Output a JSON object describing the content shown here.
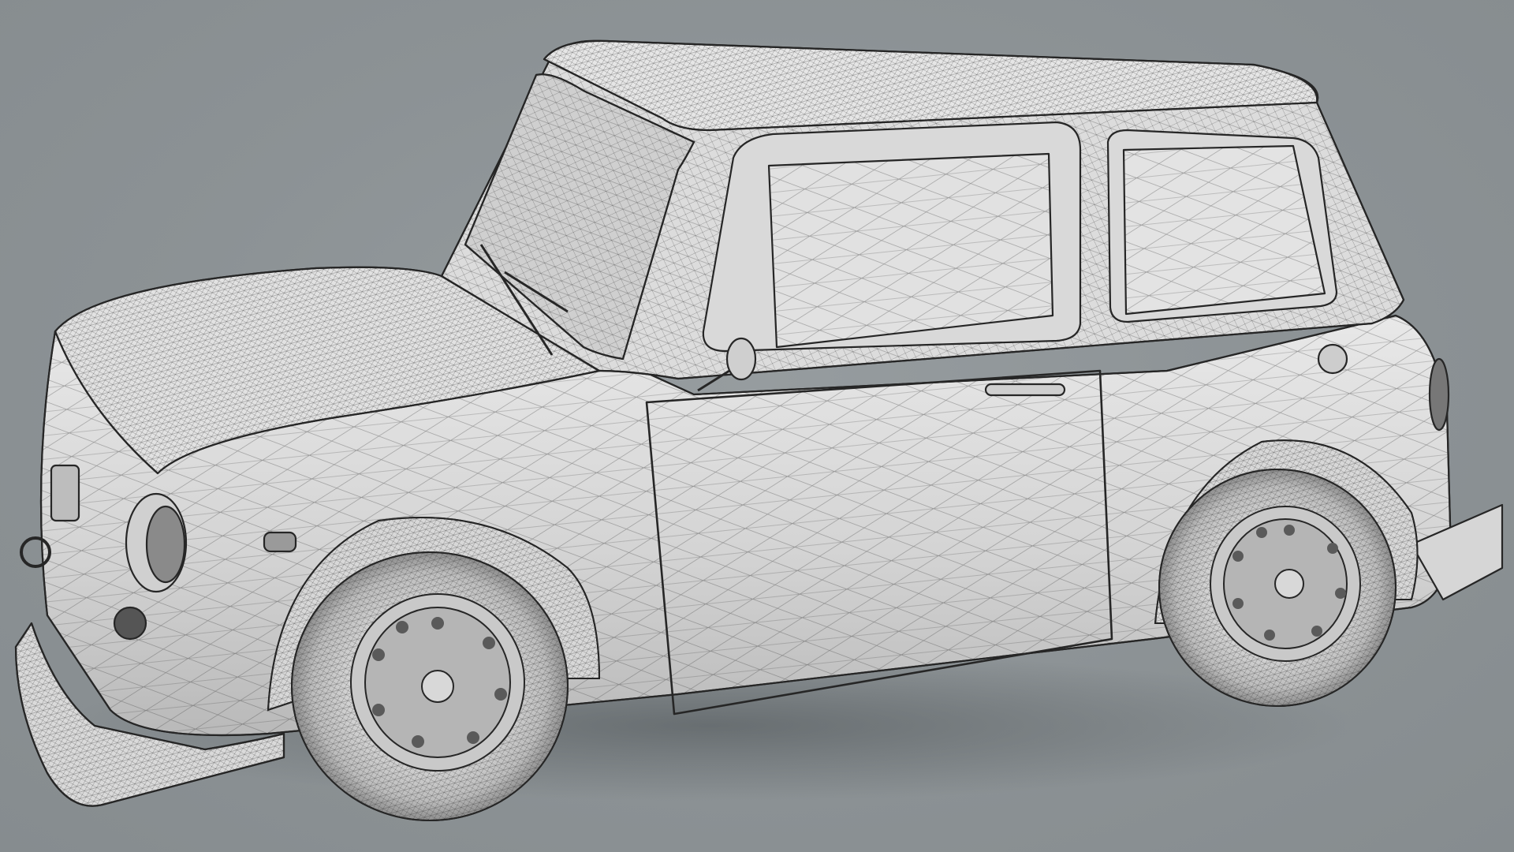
{
  "scene": {
    "background_color": "#8d9396",
    "body_color": "#dedede",
    "line_color": "#2b2b2b",
    "shadow_color": "#6f7578",
    "subject": "car-wireframe-render"
  }
}
